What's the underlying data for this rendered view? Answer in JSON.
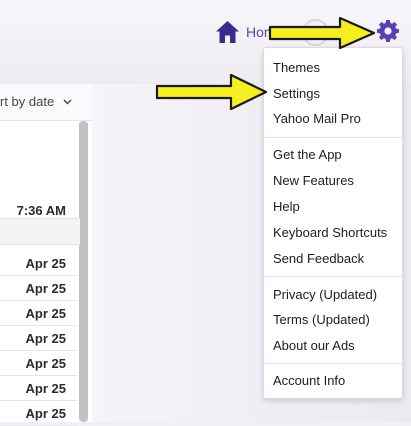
{
  "header": {
    "home_label": "Home"
  },
  "list": {
    "sort_label": "rt by date",
    "top_time": "7:36 AM",
    "dates": [
      "Apr 25",
      "Apr 25",
      "Apr 25",
      "Apr 25",
      "Apr 25",
      "Apr 25",
      "Apr 25"
    ]
  },
  "menu": {
    "group1": [
      "Themes",
      "Settings",
      "Yahoo Mail Pro"
    ],
    "group2": [
      "Get the App",
      "New Features",
      "Help",
      "Keyboard Shortcuts",
      "Send Feedback"
    ],
    "group3": [
      "Privacy (Updated)",
      "Terms (Updated)",
      "About our Ads"
    ],
    "group4": [
      "Account Info"
    ]
  },
  "colors": {
    "accent": "#5c3fb5",
    "arrow_fill": "#f5ef1f",
    "arrow_outline": "#1a1a1a"
  }
}
